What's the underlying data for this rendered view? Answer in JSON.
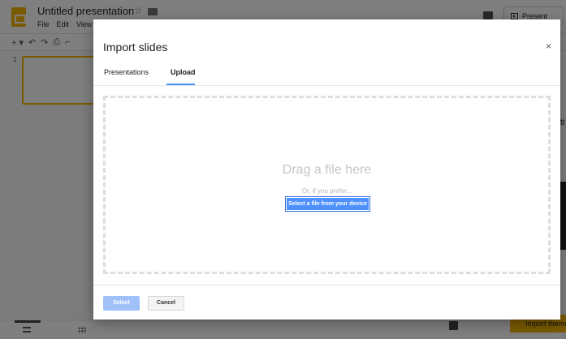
{
  "app": {
    "doc_title": "Untitled presentation",
    "menu": [
      "File",
      "Edit",
      "View"
    ],
    "present_label": "Present",
    "slide_number": "1",
    "import_theme_label": "Import theme",
    "side_panel_partial_text": "ti"
  },
  "dialog": {
    "title": "Import slides",
    "close_glyph": "×",
    "tabs": [
      {
        "label": "Presentations",
        "active": false
      },
      {
        "label": "Upload",
        "active": true
      }
    ],
    "dropzone": {
      "heading": "Drag a file here",
      "subtext": "Or, if you prefer...",
      "button_label": "Select a file from your device"
    },
    "footer": {
      "select_label": "Select",
      "cancel_label": "Cancel"
    }
  },
  "colors": {
    "accent_blue": "#4d90fe",
    "brand_yellow": "#f4b400",
    "disabled_blue": "#a0c1f8"
  }
}
